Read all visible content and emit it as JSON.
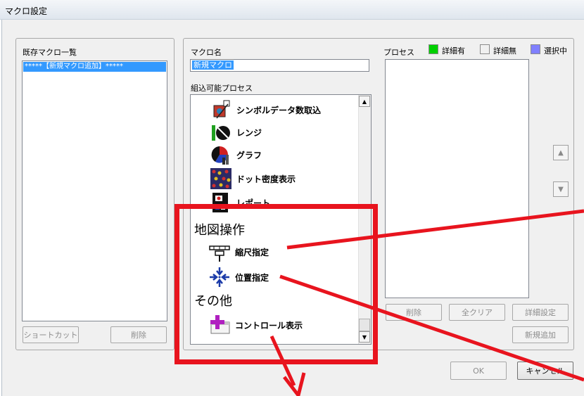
{
  "window": {
    "title": "マクロ設定"
  },
  "existing_macros": {
    "label": "既存マクロ一覧",
    "items": [
      "*****【新規マクロ追加】*****"
    ],
    "shortcut_button": "ショートカット",
    "delete_button": "削除"
  },
  "macro_name": {
    "label": "マクロ名",
    "value": "新規マクロ"
  },
  "available_processes": {
    "label": "組込可能プロセス",
    "items": [
      {
        "text": "シンボルデータ数取込",
        "icon": "symbol-data-icon"
      },
      {
        "text": "レンジ",
        "icon": "range-icon"
      },
      {
        "text": "グラフ",
        "icon": "graph-icon"
      },
      {
        "text": "ドット密度表示",
        "icon": "dot-density-icon"
      },
      {
        "text": "レポート",
        "icon": "report-icon"
      }
    ],
    "sections": [
      {
        "heading": "地図操作",
        "items": [
          {
            "text": "縮尺指定",
            "icon": "scale-icon"
          },
          {
            "text": "位置指定",
            "icon": "position-icon"
          }
        ]
      },
      {
        "heading": "その他",
        "items": [
          {
            "text": "コントロール表示",
            "icon": "control-display-icon"
          }
        ]
      }
    ]
  },
  "process": {
    "label": "プロセス",
    "legend": [
      {
        "label": "詳細有",
        "color": "#00d000"
      },
      {
        "label": "詳細無",
        "color": "#f0f0f0"
      },
      {
        "label": "選択中",
        "color": "#8080ff"
      }
    ],
    "buttons": {
      "delete": "削除",
      "clear_all": "全クリア",
      "detail_settings": "詳細設定",
      "new_add": "新規追加"
    }
  },
  "dialog_buttons": {
    "ok": "OK",
    "cancel": "キャンセル"
  },
  "colors": {
    "annotation": "#e8141e",
    "selection": "#3399ff"
  }
}
